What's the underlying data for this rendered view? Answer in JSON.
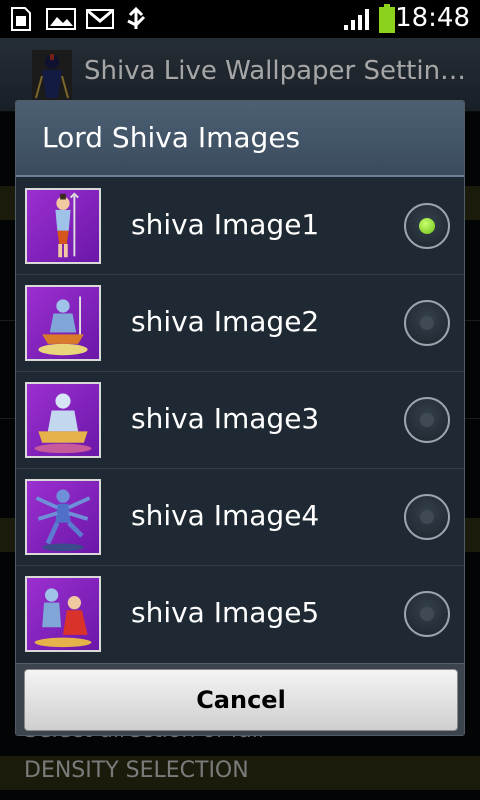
{
  "status_bar": {
    "time": "18:48",
    "icons": [
      "sim-card-icon",
      "image-icon",
      "gmail-icon",
      "usb-icon",
      "signal-icon",
      "battery-icon"
    ]
  },
  "app": {
    "title": "Shiva Live Wallpaper Settin…",
    "icon": "shiva-app-icon"
  },
  "background": {
    "density_header": "DENSITY SELECTION",
    "partial_text": "Select direction of fall"
  },
  "dialog": {
    "title": "Lord Shiva Images",
    "options": [
      {
        "label": "shiva Image1",
        "selected": true
      },
      {
        "label": "shiva Image2",
        "selected": false
      },
      {
        "label": "shiva Image3",
        "selected": false
      },
      {
        "label": "shiva Image4",
        "selected": false
      },
      {
        "label": "shiva Image5",
        "selected": false
      }
    ],
    "cancel_label": "Cancel"
  },
  "colors": {
    "accent_selected": "#8bd122",
    "thumb_purple": "#8a25c4",
    "dialog_header": "#44566a"
  }
}
